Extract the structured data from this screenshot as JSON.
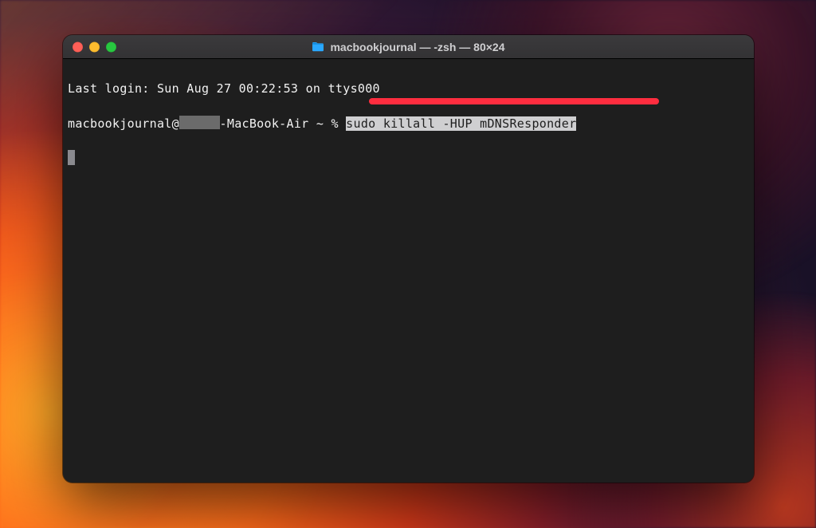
{
  "window": {
    "title": "macbookjournal — -zsh — 80×24"
  },
  "terminal": {
    "last_login_line": "Last login: Sun Aug 27 00:22:53 on ttys000",
    "prompt_prefix": "macbookjournal@",
    "prompt_host_suffix": "-MacBook-Air",
    "prompt_path_symbol": " ~ % ",
    "command": "sudo killall -HUP mDNSResponder"
  },
  "annotation": {
    "underline_color": "#ff2d3f"
  }
}
